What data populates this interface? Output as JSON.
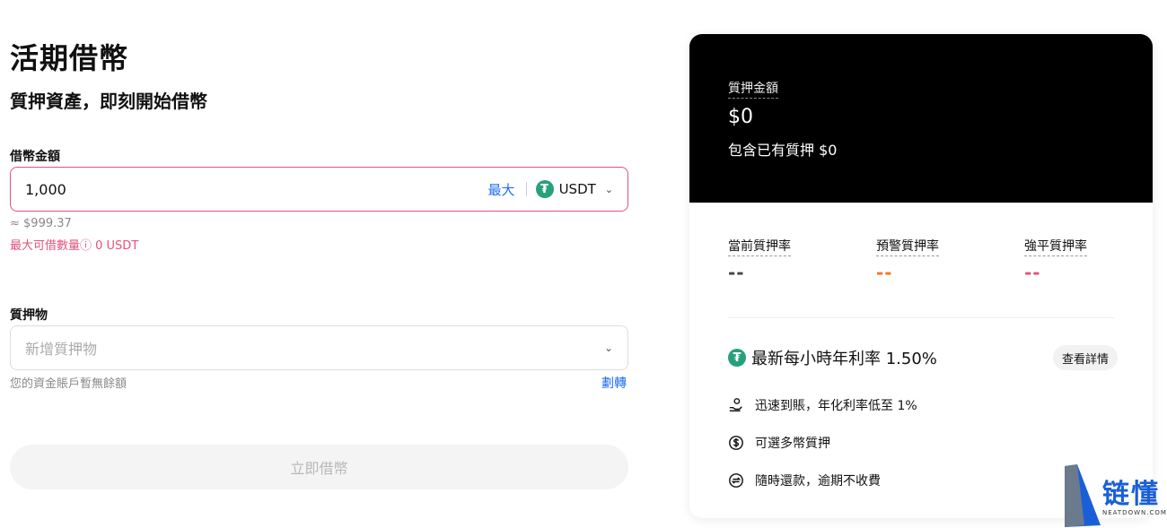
{
  "header": {
    "title": "活期借幣",
    "subtitle": "質押資產，即刻開始借幣"
  },
  "borrow_amount": {
    "label": "借幣金額",
    "value": "1,000",
    "max_label": "最大",
    "coin": "USDT",
    "approx": "≈ $999.37",
    "max_borrow": "最大可借數量ⓘ 0 USDT"
  },
  "collateral": {
    "label": "質押物",
    "placeholder": "新增質押物",
    "no_balance": "您的資金賬戶暫無餘額",
    "transfer_label": "劃轉"
  },
  "submit": {
    "label": "立即借幣"
  },
  "card": {
    "collateral_label": "質押金額",
    "collateral_value": "$0",
    "included_text": "包含已有質押 $0",
    "rates": [
      {
        "label": "當前質押率",
        "value": "--"
      },
      {
        "label": "預警質押率",
        "value": "--"
      },
      {
        "label": "強平質押率",
        "value": "--"
      }
    ],
    "latest_rate": "最新每小時年利率 1.50%",
    "details_label": "查看詳情",
    "features": [
      {
        "icon": "hand-coin-icon",
        "text": "迅速到賬，年化利率低至 1%"
      },
      {
        "icon": "dollar-circle-icon",
        "text": "可選多幣質押"
      },
      {
        "icon": "swap-circle-icon",
        "text": "隨時還款，逾期不收費"
      }
    ]
  },
  "watermark": {
    "text": "链懂",
    "small": "NEATDOWN.COM"
  },
  "colors": {
    "accent_pink": "#e5527c",
    "link_blue": "#1e6ef2",
    "usdt_green": "#26a17b",
    "warn_orange": "#f07a26"
  }
}
